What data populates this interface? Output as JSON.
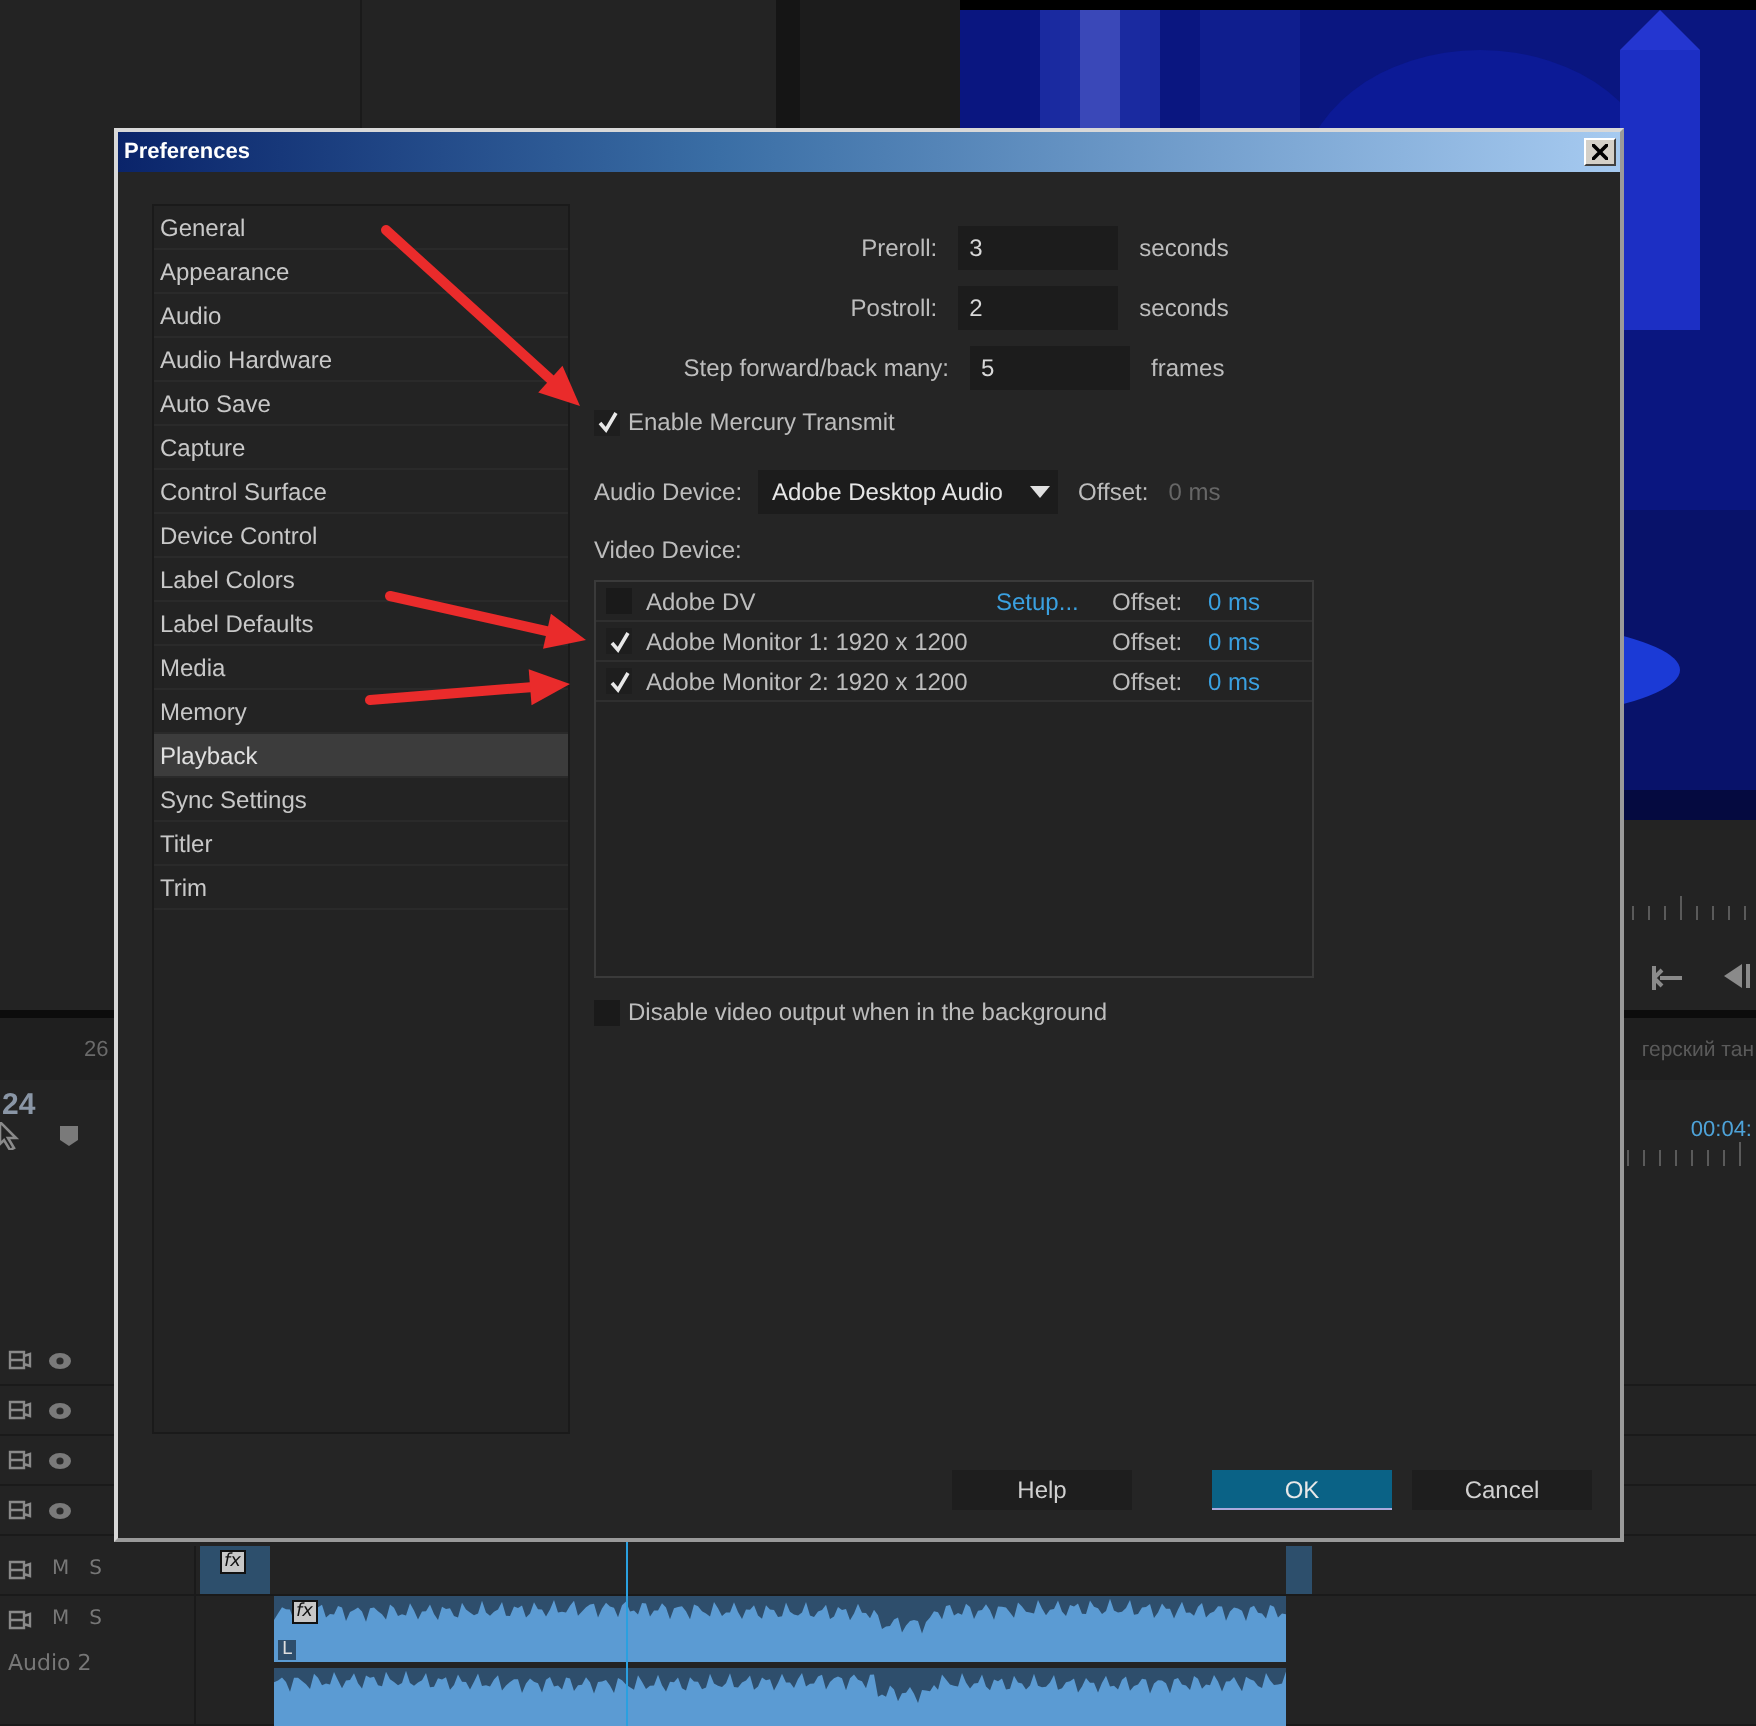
{
  "timeline": {
    "ruler_mark": "26",
    "timecode": "24",
    "sequence_name": "герский тан",
    "playhead_time": "00:04:",
    "tracks": [
      {
        "kind": "video"
      },
      {
        "kind": "video"
      },
      {
        "kind": "video"
      },
      {
        "kind": "video"
      },
      {
        "kind": "audio",
        "mute": "M",
        "solo": "S",
        "effect": "fx"
      },
      {
        "kind": "audio",
        "mute": "M",
        "solo": "S",
        "name": "Audio 2",
        "effect": "fx",
        "channel": "L"
      }
    ]
  },
  "dialog": {
    "title": "Preferences",
    "sidebar": {
      "items": [
        {
          "label": "General",
          "selected": false
        },
        {
          "label": "Appearance",
          "selected": false
        },
        {
          "label": "Audio",
          "selected": false
        },
        {
          "label": "Audio Hardware",
          "selected": false
        },
        {
          "label": "Auto Save",
          "selected": false
        },
        {
          "label": "Capture",
          "selected": false
        },
        {
          "label": "Control Surface",
          "selected": false
        },
        {
          "label": "Device Control",
          "selected": false
        },
        {
          "label": "Label Colors",
          "selected": false
        },
        {
          "label": "Label Defaults",
          "selected": false
        },
        {
          "label": "Media",
          "selected": false
        },
        {
          "label": "Memory",
          "selected": false
        },
        {
          "label": "Playback",
          "selected": true
        },
        {
          "label": "Sync Settings",
          "selected": false
        },
        {
          "label": "Titler",
          "selected": false
        },
        {
          "label": "Trim",
          "selected": false
        }
      ]
    },
    "fields": [
      {
        "label": "Preroll:",
        "value": "3",
        "unit": "seconds"
      },
      {
        "label": "Postroll:",
        "value": "2",
        "unit": "seconds"
      },
      {
        "label": "Step forward/back many:",
        "value": "5",
        "unit": "frames"
      }
    ],
    "mercury_transmit": {
      "label": "Enable Mercury Transmit",
      "checked": true
    },
    "audio_device": {
      "label": "Audio Device:",
      "value": "Adobe Desktop Audio",
      "offset_label": "Offset:",
      "offset_value": "0 ms"
    },
    "video_device": {
      "label": "Video Device:",
      "devices": [
        {
          "name": "Adobe DV",
          "checked": false,
          "setup": "Setup...",
          "offset_label": "Offset:",
          "offset_value": "0 ms"
        },
        {
          "name": "Adobe Monitor 1: 1920 x 1200",
          "checked": true,
          "offset_label": "Offset:",
          "offset_value": "0 ms"
        },
        {
          "name": "Adobe Monitor 2: 1920 x 1200",
          "checked": true,
          "offset_label": "Offset:",
          "offset_value": "0 ms"
        }
      ]
    },
    "disable_background": {
      "label": "Disable video output when in the background",
      "checked": false
    },
    "buttons": [
      {
        "label": "Help",
        "kind": "normal"
      },
      {
        "label": "OK",
        "kind": "default"
      },
      {
        "label": "Cancel",
        "kind": "normal"
      }
    ]
  },
  "annotations": [
    {
      "kind": "arrow"
    },
    {
      "kind": "arrow"
    },
    {
      "kind": "arrow"
    }
  ]
}
